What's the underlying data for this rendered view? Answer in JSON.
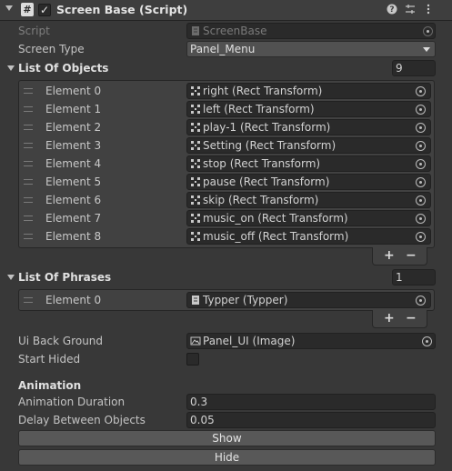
{
  "header": {
    "title": "Screen Base (Script)",
    "script_icon_glyph": "#",
    "help_icon": "help-icon",
    "preset_icon": "preset-icon",
    "menu_icon": "kebab-menu-icon"
  },
  "fields": {
    "script_label": "Script",
    "script_value": "ScreenBase",
    "screen_type_label": "Screen Type",
    "screen_type_value": "Panel_Menu"
  },
  "list_of_objects": {
    "label": "List Of Objects",
    "count": "9",
    "items": [
      {
        "label": "Element 0",
        "value": "right (Rect Transform)"
      },
      {
        "label": "Element 1",
        "value": "left (Rect Transform)"
      },
      {
        "label": "Element 2",
        "value": "play-1 (Rect Transform)"
      },
      {
        "label": "Element 3",
        "value": "Setting (Rect Transform)"
      },
      {
        "label": "Element 4",
        "value": "stop (Rect Transform)"
      },
      {
        "label": "Element 5",
        "value": "pause (Rect Transform)"
      },
      {
        "label": "Element 6",
        "value": "skip (Rect Transform)"
      },
      {
        "label": "Element 7",
        "value": "music_on (Rect Transform)"
      },
      {
        "label": "Element 8",
        "value": "music_off (Rect Transform)"
      }
    ],
    "add": "+",
    "remove": "−"
  },
  "list_of_phrases": {
    "label": "List Of Phrases",
    "count": "1",
    "items": [
      {
        "label": "Element 0",
        "value": "Typper (Typper)"
      }
    ],
    "add": "+",
    "remove": "−"
  },
  "ui_back_ground": {
    "label": "Ui Back Ground",
    "value": "Panel_UI (Image)"
  },
  "start_hided": {
    "label": "Start Hided",
    "checked": false
  },
  "animation": {
    "section": "Animation",
    "duration_label": "Animation Duration",
    "duration_value": "0.3",
    "delay_label": "Delay Between Objects",
    "delay_value": "0.05"
  },
  "buttons": {
    "show": "Show",
    "hide": "Hide"
  },
  "colors": {
    "background": "#383838",
    "field": "#2a2a2a",
    "button": "#585858"
  }
}
